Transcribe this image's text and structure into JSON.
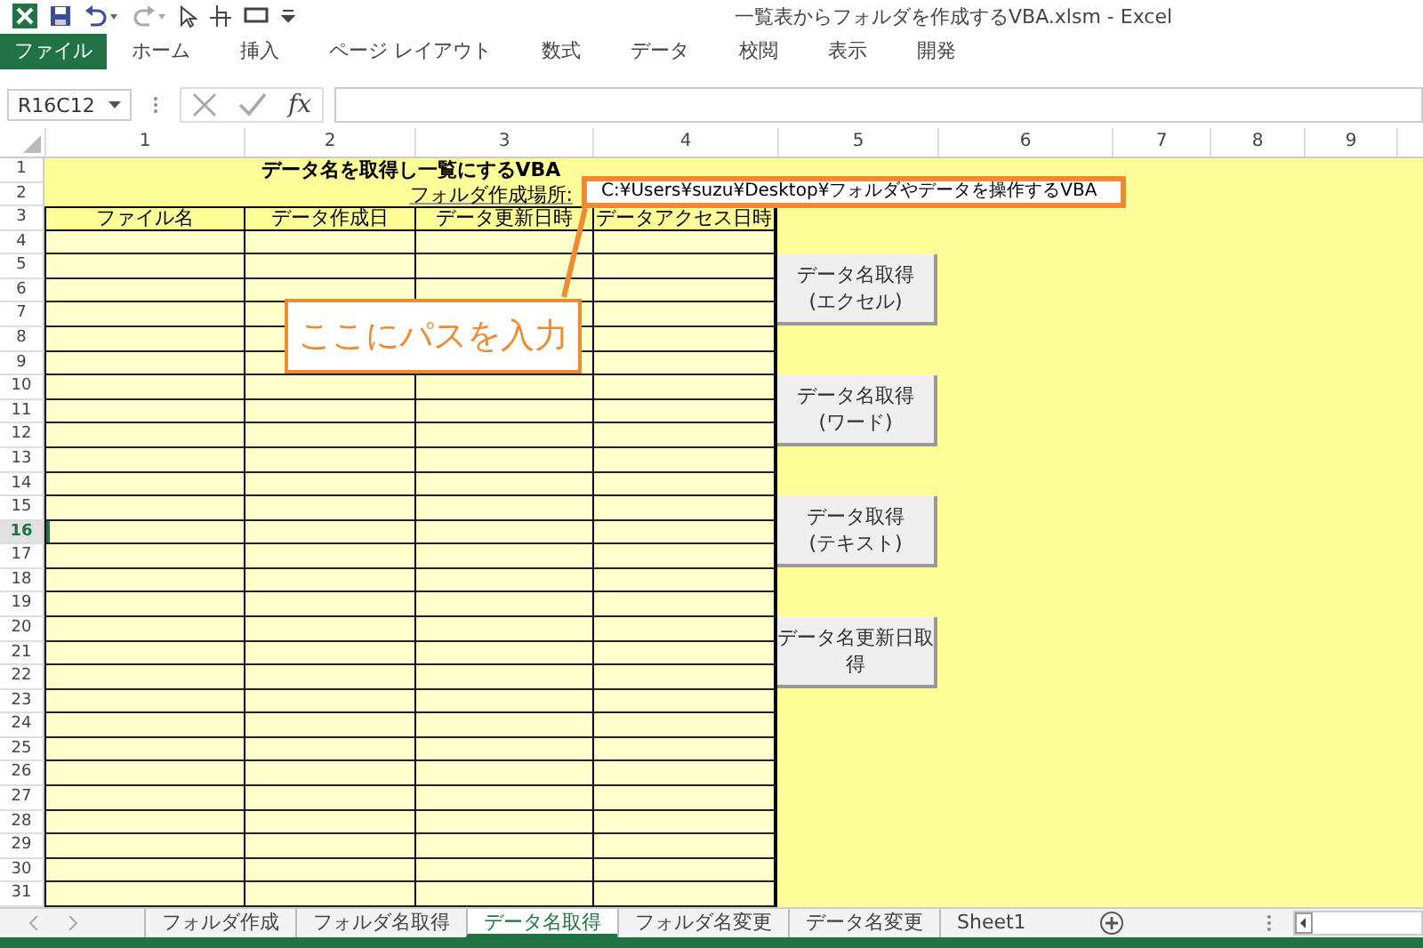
{
  "window": {
    "title": "一覧表からフォルダを作成するVBA.xlsm - Excel"
  },
  "ribbon_tabs": [
    {
      "label": "ファイル",
      "selected": true
    },
    {
      "label": "ホーム",
      "selected": false
    },
    {
      "label": "挿入",
      "selected": false
    },
    {
      "label": "ページ レイアウト",
      "selected": false
    },
    {
      "label": "数式",
      "selected": false
    },
    {
      "label": "データ",
      "selected": false
    },
    {
      "label": "校閲",
      "selected": false
    },
    {
      "label": "表示",
      "selected": false
    },
    {
      "label": "開発",
      "selected": false
    }
  ],
  "formula_bar": {
    "name_box": "R16C12",
    "fx_label": "fx"
  },
  "columns": [
    "1",
    "2",
    "3",
    "4",
    "5",
    "6",
    "7",
    "8",
    "9"
  ],
  "rows": [
    {
      "label": "1",
      "selected": false
    },
    {
      "label": "2",
      "selected": false
    },
    {
      "label": "3",
      "selected": false
    },
    {
      "label": "4",
      "selected": false
    },
    {
      "label": "5",
      "selected": false
    },
    {
      "label": "6",
      "selected": false
    },
    {
      "label": "7",
      "selected": false
    },
    {
      "label": "8",
      "selected": false
    },
    {
      "label": "9",
      "selected": false
    },
    {
      "label": "10",
      "selected": false
    },
    {
      "label": "11",
      "selected": false
    },
    {
      "label": "12",
      "selected": false
    },
    {
      "label": "13",
      "selected": false
    },
    {
      "label": "14",
      "selected": false
    },
    {
      "label": "15",
      "selected": false
    },
    {
      "label": "16",
      "selected": true
    },
    {
      "label": "17",
      "selected": false
    },
    {
      "label": "18",
      "selected": false
    },
    {
      "label": "19",
      "selected": false
    },
    {
      "label": "20",
      "selected": false
    },
    {
      "label": "21",
      "selected": false
    },
    {
      "label": "22",
      "selected": false
    },
    {
      "label": "23",
      "selected": false
    },
    {
      "label": "24",
      "selected": false
    },
    {
      "label": "25",
      "selected": false
    },
    {
      "label": "26",
      "selected": false
    },
    {
      "label": "27",
      "selected": false
    },
    {
      "label": "28",
      "selected": false
    },
    {
      "label": "29",
      "selected": false
    },
    {
      "label": "30",
      "selected": false
    },
    {
      "label": "31",
      "selected": false
    }
  ],
  "sheet": {
    "title": "データ名を取得し一覧にするVBA",
    "path_label": "フォルダ作成場所:",
    "path_value": "C:¥Users¥suzu¥Desktop¥フォルダやデータを操作するVBA",
    "table_headers": [
      "ファイル名",
      "データ作成日",
      "データ更新日時",
      "データアクセス日時"
    ],
    "buttons": [
      {
        "lines": [
          "データ名取得",
          "(エクセル)"
        ]
      },
      {
        "lines": [
          "データ名取得",
          "(ワード)"
        ]
      },
      {
        "lines": [
          "データ取得",
          "(テキスト)"
        ]
      },
      {
        "lines": [
          "データ名更新日取",
          "得"
        ]
      }
    ],
    "callout": "ここにパスを入力"
  },
  "sheet_tabs": [
    {
      "label": "フォルダ作成",
      "selected": false
    },
    {
      "label": "フォルダ名取得",
      "selected": false
    },
    {
      "label": "データ名取得",
      "selected": true
    },
    {
      "label": "フォルダ名変更",
      "selected": false
    },
    {
      "label": "データ名変更",
      "selected": false
    },
    {
      "label": "Sheet1",
      "selected": false
    }
  ]
}
